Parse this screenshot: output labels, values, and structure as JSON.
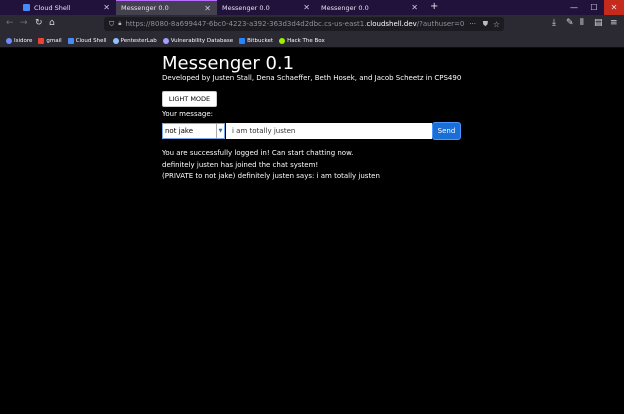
{
  "tabs": [
    {
      "title": "Cloud Shell",
      "active": false
    },
    {
      "title": "Messenger 0.0",
      "active": true
    },
    {
      "title": "Messenger 0.0",
      "active": false
    },
    {
      "title": "Messenger 0.0",
      "active": false
    }
  ],
  "new_tab_symbol": "+",
  "url": {
    "prefix": "https://8080-8a699447-6bc0-4223-a392-363d3d4d2dbc.cs-us-east1.",
    "host": "cloudshell.dev",
    "suffix": "/?authuser=0"
  },
  "bookmarks": [
    "Isidore",
    "gmail",
    "Cloud Shell",
    "PentesterLab",
    "Vulnerability Database",
    "Bitbucket",
    "Hack The Box"
  ],
  "page": {
    "title": "Messenger 0.1",
    "subtitle": "Developed by Justen Stall, Dena Schaeffer, Beth Hosek, and Jacob Scheetz in CPS490",
    "light_mode_label": "LIGHT MODE",
    "your_message_label": "Your message:",
    "recipient": "not jake",
    "message_value": "i am totally justen",
    "send_label": "Send",
    "messages": [
      "You are successfully logged in! Can start chatting now.",
      "definitely justen has joined the chat system!",
      "(PRIVATE to not jake) definitely justen says: i am totally justen"
    ]
  },
  "colors": {
    "accent": "#1a6fd6",
    "tabstrip": "#20123a",
    "page_bg": "#000000"
  }
}
